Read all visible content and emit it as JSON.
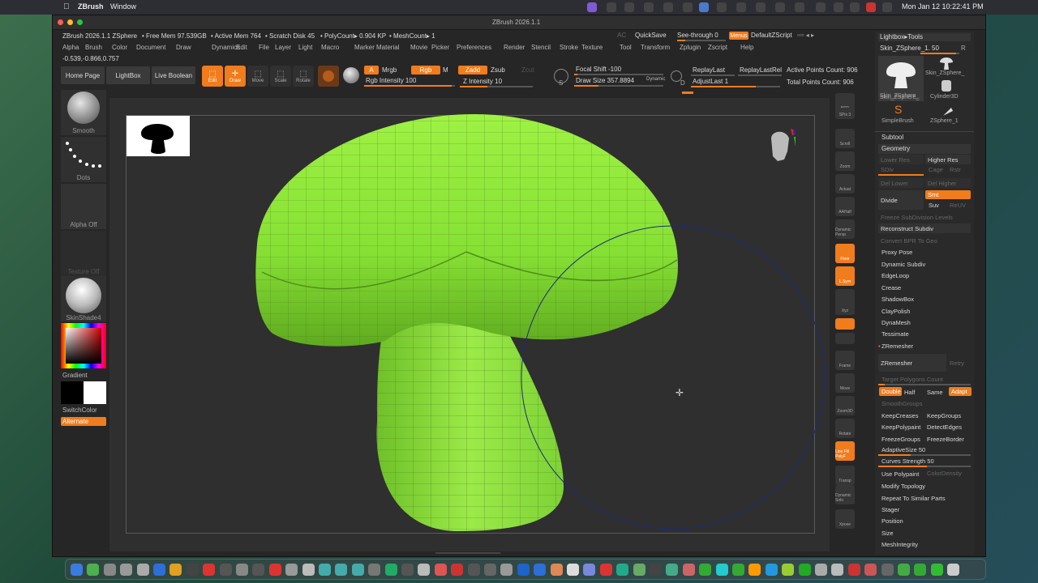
{
  "mac": {
    "app": "ZBrush",
    "menu": "Window",
    "datetime": "Mon Jan 12  10:22:41 PM"
  },
  "title": "ZBrush 2026.1.1",
  "stats": {
    "product": "ZBrush 2026.1.1 ZSphere",
    "free_mem": "• Free Mem 97.539GB",
    "active_mem": "• Active Mem 764",
    "scratch": "• Scratch Disk 45",
    "polycount": "• PolyCount▸ 0.904 KP",
    "meshcount": "• MeshCount▸ 1",
    "coords": "-0.539,-0.866,0.757"
  },
  "header": {
    "ac": "AC",
    "quicksave": "QuickSave",
    "seethrough": "See-through  0",
    "menus": "Menus",
    "defaultzscript": "DefaultZScript"
  },
  "menu": [
    "Alpha",
    "Brush",
    "Color",
    "Document",
    "Draw",
    "Dynamics",
    "Edit",
    "File",
    "Layer",
    "Light",
    "Macro",
    "Marker",
    "Material",
    "Movie",
    "Picker",
    "Preferences",
    "Render",
    "Stencil",
    "Stroke",
    "Texture",
    "Tool",
    "Transform",
    "Zplugin",
    "Zscript",
    "Help"
  ],
  "shelf": {
    "home": "Home Page",
    "lightbox": "LightBox",
    "live_boolean": "Live Boolean",
    "edit": "Edit",
    "draw": "Draw",
    "move": "Move",
    "scale": "Scale",
    "rotate": "Rotate",
    "a": "A",
    "mrgb": "Mrgb",
    "rgb": "Rgb",
    "m": "M",
    "zadd": "Zadd",
    "zsub": "Zsub",
    "zcut": "Zcut",
    "rgb_intensity": "Rgb Intensity 100",
    "z_intensity": "Z Intensity 10",
    "focal_shift": "Focal Shift -100",
    "draw_size": "Draw Size 357.8894",
    "dynamic": "Dynamic",
    "replaylast": "ReplayLast",
    "replaylastrel": "ReplayLastRel",
    "adjustlast": "AdjustLast 1",
    "active_points": "Active Points Count: 906",
    "total_points": "Total Points Count: 906",
    "s_label": "S",
    "d_label": "D"
  },
  "left": {
    "smooth": "Smooth",
    "dots": "Dots",
    "alpha_off": "Alpha Off",
    "texture_off": "Texture Off",
    "material": "SkinShade4",
    "gradient": "Gradient",
    "switchcolor": "SwitchColor",
    "alternate": "Alternate"
  },
  "rightbar": [
    "BPR",
    "SPix 3",
    "Scroll",
    "Zoom",
    "Actual",
    "AAHalf",
    "Dynamic Persp",
    "Floor",
    "L.Sym",
    "",
    "Xyz",
    "",
    "",
    "Frame",
    "Move",
    "Zoom3D",
    "Rotate",
    "Line Fill PolyF",
    "Transp",
    "Dynamic Solo",
    "Xpose"
  ],
  "tools": {
    "header": "Lightbox▸Tools",
    "current": "Skin_ZSphere_1. 50",
    "r": "R",
    "items": [
      "Skin_ZSphere_",
      "Skin_ZSphere_",
      "Skin_ZSphere_",
      "Cylinder3D",
      "SimpleBrush",
      "ZSphere_1"
    ]
  },
  "subtool": "Subtool",
  "geometry": {
    "title": "Geometry",
    "lower_res": "Lower Res",
    "higher_res": "Higher Res",
    "sdiv": "SDiv",
    "cage": "Cage",
    "rstr": "Rstr",
    "del_lower": "Del Lower",
    "del_higher": "Del Higher",
    "divide": "Divide",
    "smt": "Smt",
    "suv": "Suv",
    "reuv": "ReUV",
    "freeze": "Freeze SubDivision Levels",
    "reconstruct": "Reconstruct Subdiv",
    "convert_bpr": "Convert BPR To Geo",
    "items": [
      "Proxy Pose",
      "Dynamic Subdiv",
      "EdgeLoop",
      "Crease",
      "ShadowBox",
      "ClayPolish",
      "DynaMesh",
      "Tessimate"
    ]
  },
  "zremesher": {
    "title": "ZRemesher",
    "button": "ZRemesher",
    "retry": "Retry",
    "target": "Target Polygons Count",
    "double": "Double",
    "half": "Half",
    "same": "Same",
    "adapt": "Adapt",
    "smoothgroups": "SmoothGroups",
    "keepcreases": "KeepCreases",
    "keepgroups": "KeepGroups",
    "keeppolypaint": "KeepPolypaint",
    "detectedges": "DetectEdges",
    "freezegroups": "FreezeGroups",
    "freezeborder": "FreezeBorder",
    "adaptivesize": "AdaptiveSize 50",
    "curves": "Curves Strength 50",
    "use_polypaint": "Use Polypaint",
    "colordensity": "ColorDensity"
  },
  "lower_items": [
    "Modify Topology",
    "Repeat To Similar Parts",
    "Stager",
    "Position",
    "Size",
    "MeshIntegrity"
  ],
  "colors": {
    "accent": "#f07c1c",
    "mesh": "#8ee63a",
    "canvas": "#2f2f2f"
  }
}
